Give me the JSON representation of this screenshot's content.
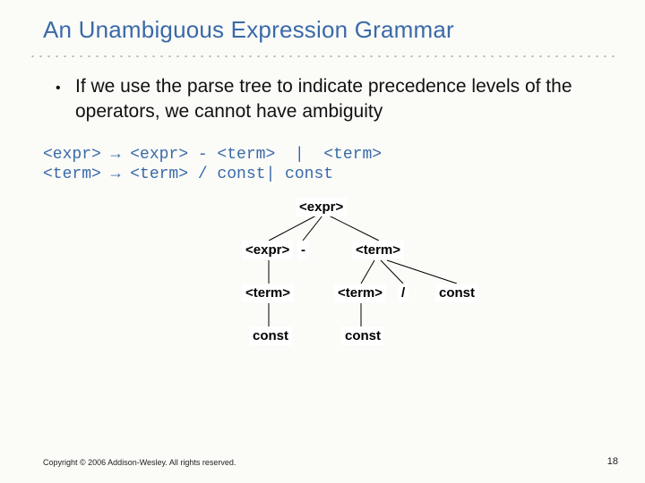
{
  "title": "An Unambiguous Expression Grammar",
  "bullet": {
    "text": "If we use the parse tree to indicate precedence levels of the operators, we cannot have ambiguity"
  },
  "grammar": {
    "line1": "<expr> → <expr> - <term>  |  <term>",
    "line2": "<term> → <term> / const| const"
  },
  "tree": {
    "n_expr_top": "<expr>",
    "n_expr_l": "<expr>",
    "n_minus": "-",
    "n_term_r": "<term>",
    "n_term_ll": "<term>",
    "n_term_rl": "<term>",
    "n_slash": "/",
    "n_const_rr": "const",
    "n_const_lll": "const",
    "n_const_rll": "const"
  },
  "footer": {
    "copyright": "Copyright © 2006 Addison-Wesley. All rights reserved.",
    "page": "18"
  }
}
